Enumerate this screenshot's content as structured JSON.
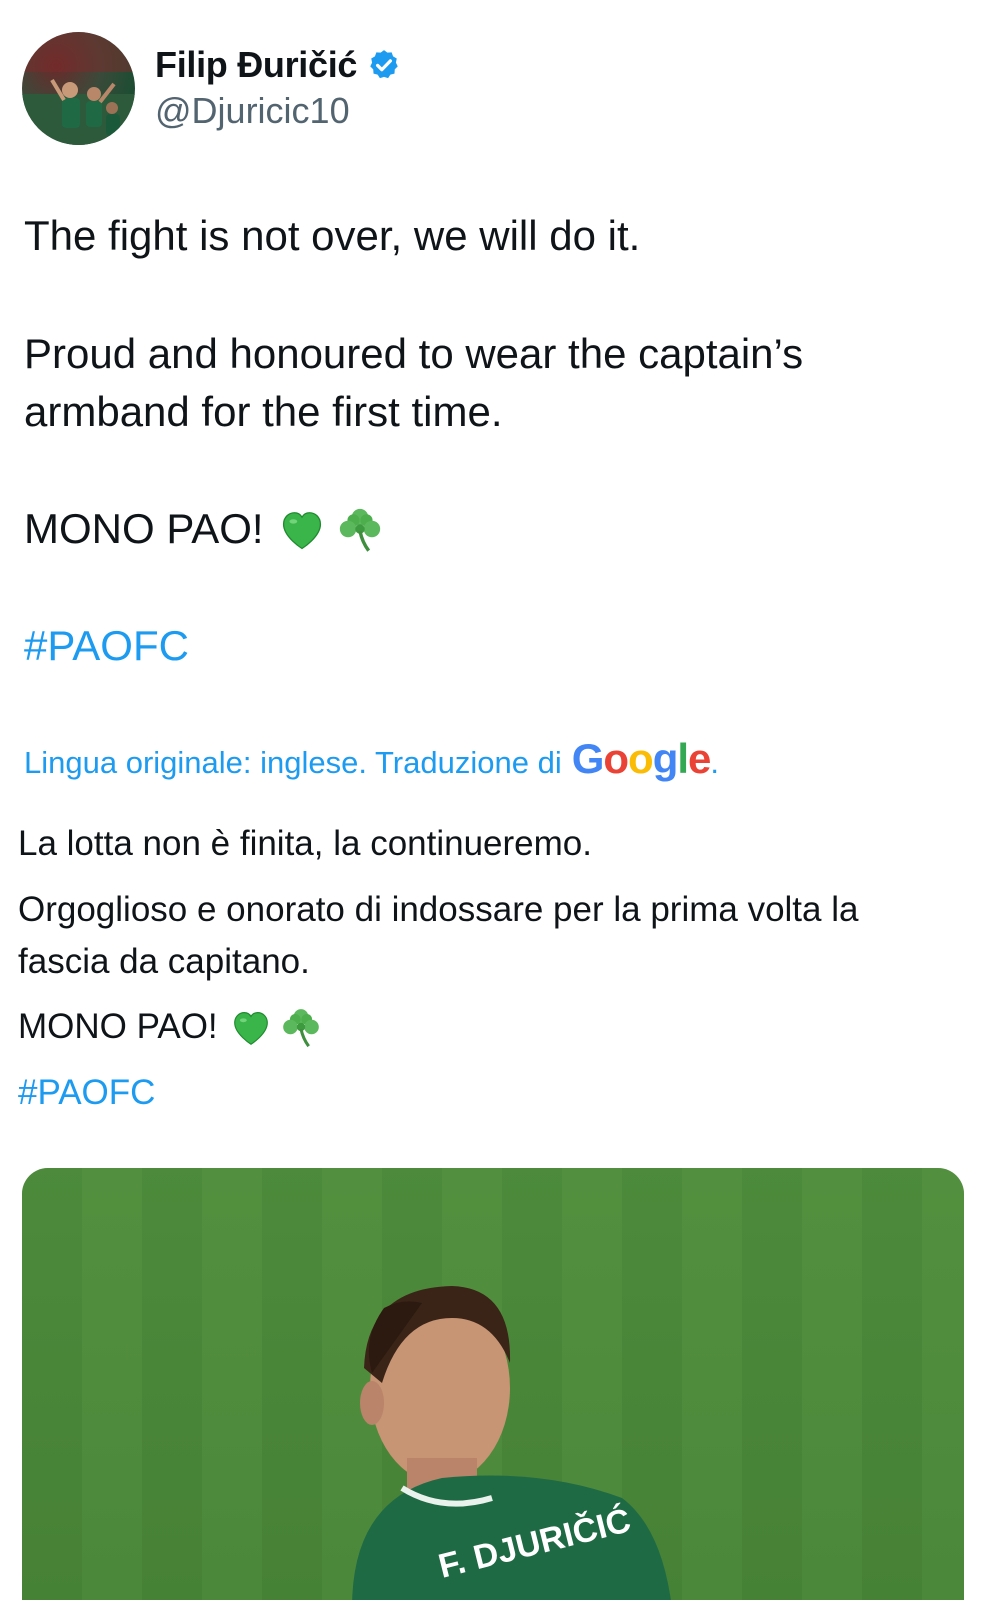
{
  "author": {
    "display_name": "Filip Đuričić",
    "handle": "@Djuricic10",
    "verified": true,
    "avatar_icon": "profile-photo"
  },
  "tweet": {
    "line1": "The fight is not over, we will do it.",
    "line2": "Proud and honoured to wear the captain’s\narmband for the first time.",
    "line3": "MONO PAO!",
    "hashtag": "#PAOFC",
    "emojis": [
      "green-heart-emoji",
      "shamrock-emoji"
    ]
  },
  "translation": {
    "note": "Lingua originale: inglese. Traduzione di",
    "provider": "Google",
    "period": ".",
    "line1": "La lotta non è finita, la continueremo.",
    "line2": "Orgoglioso e onorato di indossare per la prima volta la\nfascia da capitano.",
    "line3": "MONO PAO!",
    "hashtag": "#PAOFC"
  },
  "media": {
    "jersey_text": "F. DJURIČIĆ"
  },
  "colors": {
    "link": "#1d9bf0",
    "text": "#0f1419",
    "secondary": "#536471",
    "verified": "#1d9bf0"
  }
}
